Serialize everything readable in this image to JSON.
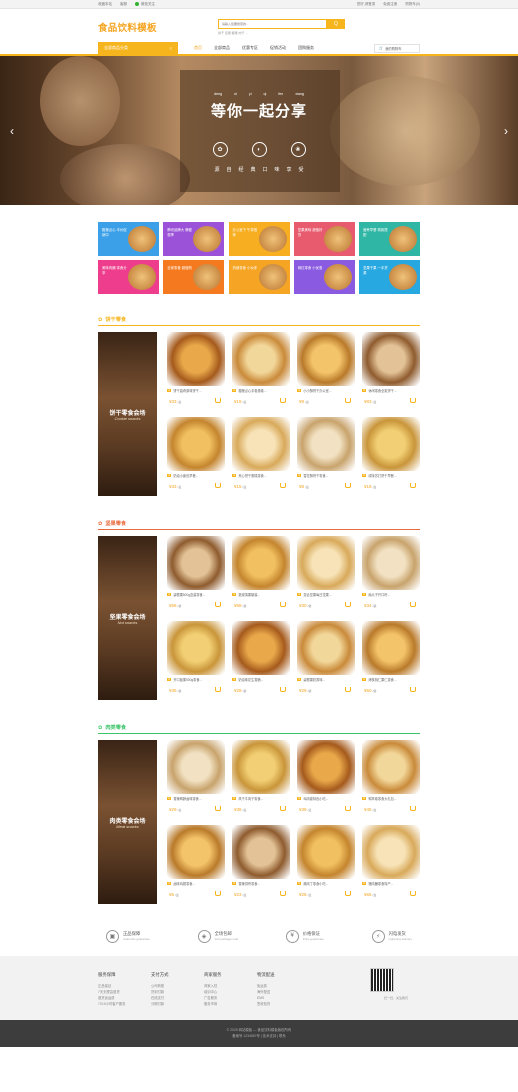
{
  "topbar": {
    "left": [
      "收藏本站",
      "客服",
      "微信关注"
    ],
    "right": [
      "您好,请登录",
      "免费注册",
      "购物车(0)"
    ]
  },
  "header": {
    "logo": "食品饮料模板",
    "search_placeholder": "请输入您要搜索的...",
    "search_button": "Q",
    "hot_words": "饼干 坚果  糖果 肉干 ..."
  },
  "nav": {
    "category_button": "全部商品分类",
    "items": [
      "首页",
      "全部商品",
      "优惠专区",
      "促销活动",
      "团购服务"
    ],
    "cart": "我的购物车"
  },
  "banner": {
    "pinyin": [
      "deng",
      "ni",
      "yi",
      "qi",
      "fen",
      "xiang"
    ],
    "title": "等你一起分享",
    "icons": [
      "✿",
      "◐",
      "❀"
    ],
    "subtitle": [
      "源",
      "自",
      "经",
      "典",
      "口",
      "味",
      "享",
      "受"
    ],
    "prev": "‹",
    "next": "›"
  },
  "promos": [
    {
      "text": "粗粮点心 半价促销中",
      "color": "#3ca0e8"
    },
    {
      "text": "腾讯品牌大 牌盛惠季",
      "color": "#9b52d8"
    },
    {
      "text": "办公室下 午茶推荐",
      "color": "#f7ae20"
    },
    {
      "text": "坚果美味 超值好货",
      "color": "#e85a6d"
    },
    {
      "text": "营养早餐 精致搭配",
      "color": "#2fb6a4"
    },
    {
      "text": "美味肉脯 零食分享",
      "color": "#ed3d8c"
    },
    {
      "text": "全家零食 超值购",
      "color": "#f57a1f"
    },
    {
      "text": "热销零食 小伙伴",
      "color": "#f5a423"
    },
    {
      "text": "网红零食 小优惠",
      "color": "#8a5ae0"
    },
    {
      "text": "坚果干果 一手货源",
      "color": "#28a8e0"
    }
  ],
  "sections": [
    {
      "title": "饼干零食",
      "color": "#f6b51d",
      "side_title": "饼干零食会场",
      "side_sub": "Cookie snacks",
      "products": [
        {
          "name": "饼干曲奇原味饼干...",
          "price": "¥33",
          "unit": "/盒"
        },
        {
          "name": "粗粮点心手卷蛋卷...",
          "price": "¥15",
          "unit": "/盒"
        },
        {
          "name": "小小酥饼干办公室...",
          "price": "¥8",
          "unit": "/盒"
        },
        {
          "name": "休闲零食全麦饼干...",
          "price": "¥83",
          "unit": "/盒"
        },
        {
          "name": "奶油小面包早餐...",
          "price": "¥33",
          "unit": "/盒"
        },
        {
          "name": "夹心饼干蛋糕零食...",
          "price": "¥15",
          "unit": "/盒"
        },
        {
          "name": "雪花酥饼干零食...",
          "price": "¥8",
          "unit": "/盒"
        },
        {
          "name": "咸味苏打饼干早餐...",
          "price": "¥18",
          "unit": "/盒"
        }
      ]
    },
    {
      "title": "坚果零食",
      "color": "#e86a3c",
      "side_title": "坚果零食会场",
      "side_sub": "Nut snacks",
      "products": [
        {
          "name": "碧根果500g盒装零食...",
          "price": "¥58",
          "unit": "/袋"
        },
        {
          "name": "夏威夷果罐装...",
          "price": "¥58",
          "unit": "/袋"
        },
        {
          "name": "混合坚果每日坚果...",
          "price": "¥30",
          "unit": "/袋"
        },
        {
          "name": "南瓜子开口籽...",
          "price": "¥34",
          "unit": "/袋"
        },
        {
          "name": "开口板栗500g零食...",
          "price": "¥35",
          "unit": "/袋"
        },
        {
          "name": "奶油味花生香脆...",
          "price": "¥28",
          "unit": "/袋"
        },
        {
          "name": "碧根果奶香味...",
          "price": "¥29",
          "unit": "/袋"
        },
        {
          "name": "烤核桃仁果仁零食...",
          "price": "¥50",
          "unit": "/袋"
        }
      ]
    },
    {
      "title": "肉类零食",
      "color": "#3cc46a",
      "side_title": "肉类零食会场",
      "side_sub": "Meat snacks",
      "products": [
        {
          "name": "香辣鸭脖卤味零食...",
          "price": "¥29",
          "unit": "/盒"
        },
        {
          "name": "风干牛肉干零食...",
          "price": "¥36",
          "unit": "/盒"
        },
        {
          "name": "鸡肉卷特色小吃...",
          "price": "¥39",
          "unit": "/盒"
        },
        {
          "name": "鸭掌卷零食大礼包...",
          "price": "¥45",
          "unit": "/盒"
        },
        {
          "name": "卤味鸡翅零食...",
          "price": "¥5",
          "unit": "/盒"
        },
        {
          "name": "香辣排骨零食...",
          "price": "¥23",
          "unit": "/盒"
        },
        {
          "name": "酱肉丁零食小吃...",
          "price": "¥28",
          "unit": "/盒"
        },
        {
          "name": "猪肉脯零食特产...",
          "price": "¥65",
          "unit": "/盒"
        }
      ]
    }
  ],
  "services": [
    {
      "icon": "▣",
      "title": "正品保障",
      "sub": "Authentic guarantee"
    },
    {
      "icon": "◈",
      "title": "全场包邮",
      "sub": "Full package mail"
    },
    {
      "icon": "¥",
      "title": "价格保证",
      "sub": "Price guarantee"
    },
    {
      "icon": "⚡",
      "title": "闪电发货",
      "sub": "Lightning delivery"
    }
  ],
  "footer": {
    "columns": [
      {
        "title": "服务保障",
        "links": [
          "正品保证",
          "7天无理由退货",
          "退货返运费",
          "7X15小时客户服务"
        ]
      },
      {
        "title": "支付方式",
        "links": [
          "公司转账",
          "货到付款",
          "在线支付",
          "分期付款"
        ]
      },
      {
        "title": "商家服务",
        "links": [
          "商家入驻",
          "培训中心",
          "广告服务",
          "服务市场"
        ]
      },
      {
        "title": "物流配送",
        "links": [
          "免运费",
          "海外配送",
          "EMS",
          "签收验货"
        ]
      }
    ],
    "qr_caption": "扫一扫，关注我们",
    "copyright": "© 2025 网站模板 — 食品饮料模板版权所有",
    "icp": "备案号 1234567号  |  技术支持  |  联系"
  }
}
